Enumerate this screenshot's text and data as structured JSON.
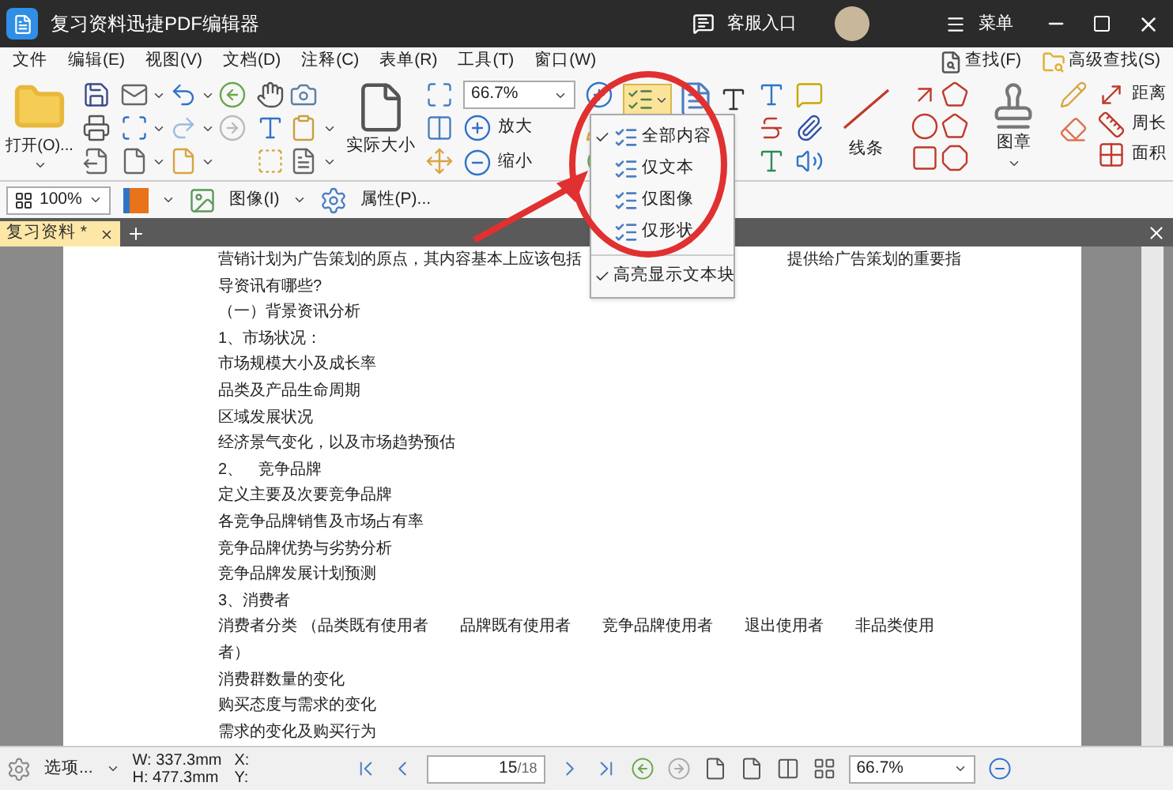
{
  "window": {
    "title": "复习资料迅捷PDF编辑器",
    "support": "客服入口",
    "menu": "菜单"
  },
  "menubar": {
    "items": [
      "文件",
      "编辑(E)",
      "视图(V)",
      "文档(D)",
      "注释(C)",
      "表单(R)",
      "工具(T)",
      "窗口(W)"
    ],
    "find": "查找(F)",
    "advanced_find": "高级查找(S)"
  },
  "ribbon": {
    "open": "打开(O)...",
    "actual_size": "实际大小",
    "zoom": "66.7%",
    "zoom_in": "放大",
    "zoom_out": "缩小",
    "line": "线条",
    "stamp": "图章",
    "distance": "距离",
    "perimeter": "周长",
    "area": "面积"
  },
  "toolbar": {
    "opacity": "100%",
    "image": "图像(I)",
    "properties": "属性(P)..."
  },
  "tabs": [
    {
      "label": "复习资料 *",
      "selected": true
    }
  ],
  "dropdown": {
    "items": [
      {
        "label": "全部内容",
        "checked": true
      },
      {
        "label": "仅文本",
        "checked": false
      },
      {
        "label": "仅图像",
        "checked": false
      },
      {
        "label": "仅形状",
        "checked": false
      }
    ],
    "highlight": {
      "label": "高亮显示文本块",
      "checked": true
    }
  },
  "document": {
    "first_line": {
      "before": "营销计划为广告策划的原点，其内容基本上应该包括",
      "after": "提供给广告策划的重要指"
    },
    "lines": [
      "导资讯有哪些?",
      "（一）背景资讯分析",
      "1、市场状况：",
      "市场规模大小及成长率",
      "品类及产品生命周期",
      "区域发展状况",
      "经济景气变化，以及市场趋势预估",
      "2、　竞争品牌",
      "定义主要及次要竞争品牌",
      "各竞争品牌销售及市场占有率",
      "竞争品牌优势与劣势分析",
      "竞争品牌发展计划预测",
      "3、消费者",
      "消费者分类 （品类既有使用者　　品牌既有使用者　　竞争品牌使用者　　退出使用者　　非品类使用",
      "者）",
      "消费群数量的变化",
      "购买态度与需求的变化",
      "需求的变化及购买行为"
    ]
  },
  "status_bar": {
    "options": "选项...",
    "width": "W: 337.3mm",
    "height": "H: 477.3mm",
    "x": "X:",
    "y": "Y:",
    "page": "15",
    "page_total": "/18",
    "zoom": "66.7%"
  }
}
